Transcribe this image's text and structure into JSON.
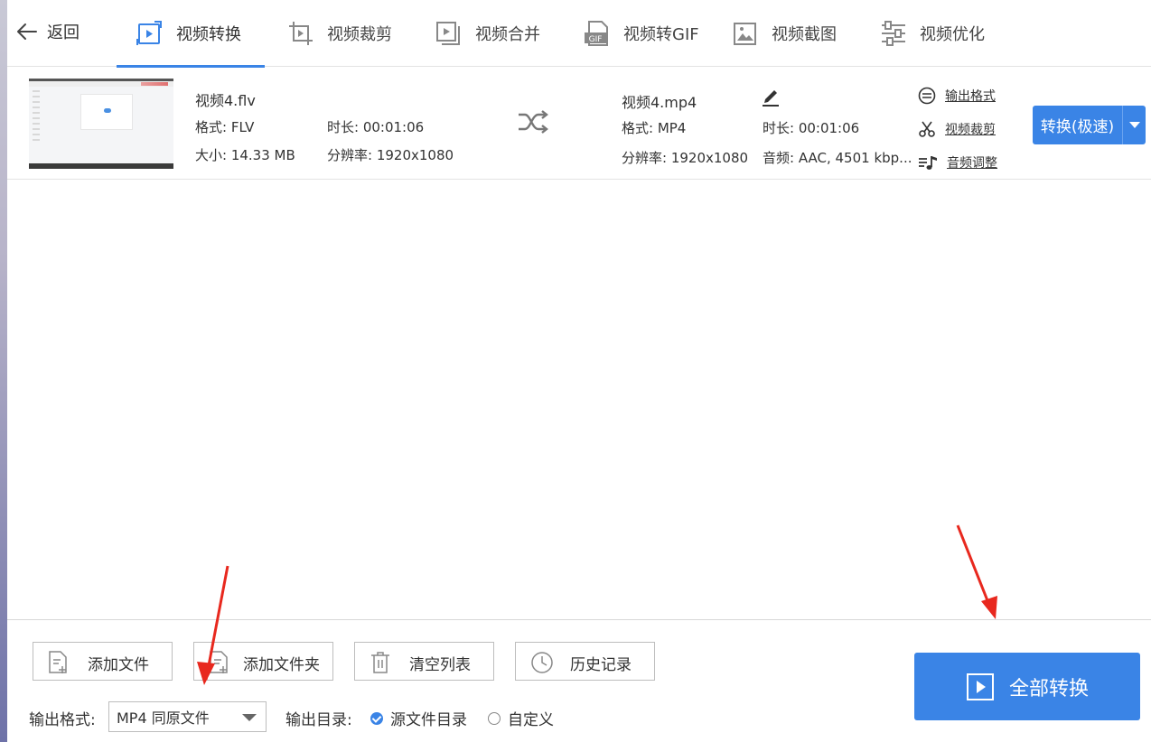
{
  "nav": {
    "back_label": "返回",
    "tabs": [
      {
        "label": "视频转换",
        "icon": "video-convert-icon",
        "active": true
      },
      {
        "label": "视频裁剪",
        "icon": "video-crop-icon",
        "active": false
      },
      {
        "label": "视频合并",
        "icon": "video-merge-icon",
        "active": false
      },
      {
        "label": "视频转GIF",
        "icon": "gif-icon",
        "active": false
      },
      {
        "label": "视频截图",
        "icon": "image-icon",
        "active": false
      },
      {
        "label": "视频优化",
        "icon": "sliders-icon",
        "active": false
      }
    ]
  },
  "file": {
    "source": {
      "name": "视频4.flv",
      "format": "格式: FLV",
      "duration": "时长: 00:01:06",
      "size": "大小: 14.33 MB",
      "resolution": "分辨率: 1920x1080"
    },
    "output": {
      "name": "视频4.mp4",
      "format": "格式: MP4",
      "duration": "时长: 00:01:06",
      "resolution": "分辨率: 1920x1080",
      "audio": "音频: AAC, 4501 kbp..."
    },
    "actions": {
      "output_format": "输出格式",
      "video_crop": "视频裁剪",
      "audio_adjust": "音频调整"
    },
    "convert_button": "转换(极速)"
  },
  "toolbar": {
    "add_file": "添加文件",
    "add_folder": "添加文件夹",
    "clear_list": "清空列表",
    "history": "历史记录",
    "convert_all": "全部转换"
  },
  "output": {
    "format_label": "输出格式:",
    "format_value": "MP4 同原文件",
    "dir_label": "输出目录:",
    "dir_options": [
      {
        "label": "源文件目录",
        "selected": true
      },
      {
        "label": "自定义",
        "selected": false
      }
    ]
  },
  "colors": {
    "accent": "#3a84e6",
    "annotation_arrow": "#e8281e"
  }
}
